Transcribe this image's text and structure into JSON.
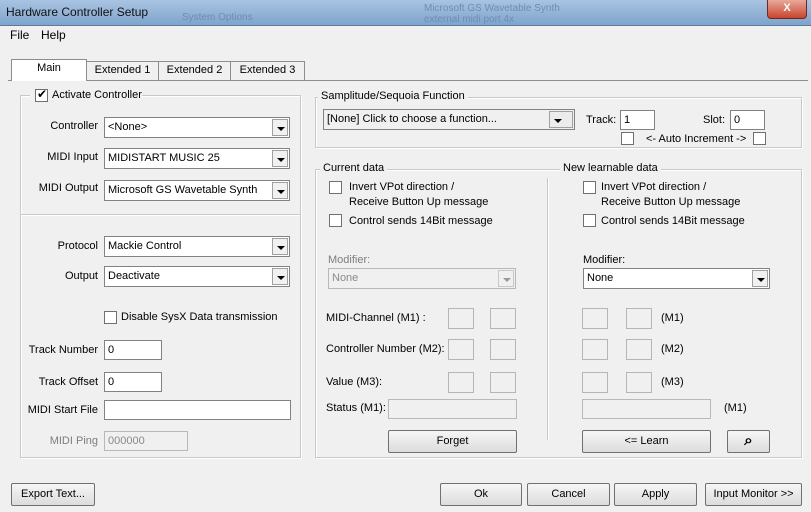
{
  "window": {
    "title": "Hardware Controller Setup",
    "bg_text_1": "System Options",
    "bg_text_2": "Microsoft GS Wavetable Synth",
    "bg_text_3": "external midi port 4x",
    "close_label": "X"
  },
  "menu": [
    "File",
    "Help"
  ],
  "tabs": [
    "Main",
    "Extended 1",
    "Extended 2",
    "Extended 3"
  ],
  "left": {
    "activate_label": "Activate Controller",
    "activate_checked": true,
    "check_mark": "✔",
    "controller_label": "Controller",
    "controller_value": "<None>",
    "midi_input_label": "MIDI Input",
    "midi_input_value": "MIDISTART MUSIC 25",
    "midi_output_label": "MIDI Output",
    "midi_output_value": "Microsoft GS Wavetable Synth",
    "protocol_label": "Protocol",
    "protocol_value": "Mackie Control",
    "output_label": "Output",
    "output_value": "Deactivate",
    "disable_sysx_label": "Disable SysX Data transmission",
    "disable_sysx_checked": false,
    "track_number_label": "Track Number",
    "track_number_value": "0",
    "track_offset_label": "Track Offset",
    "track_offset_value": "0",
    "midi_start_file_label": "MIDI Start File",
    "midi_start_file_value": "",
    "midi_ping_label": "MIDI Ping",
    "midi_ping_value": "000000"
  },
  "function": {
    "group_title": "Samplitude/Sequoia Function",
    "value": "[None] Click to choose a function...",
    "track_label": "Track:",
    "track_value": "1",
    "slot_label": "Slot:",
    "slot_value": "0",
    "auto_increment_label": "<- Auto Increment ->"
  },
  "current": {
    "title": "Current data",
    "invert_label_1": "Invert VPot direction /",
    "invert_label_2": "Receive Button Up message",
    "send14_label": "Control sends 14Bit message",
    "modifier_label": "Modifier:",
    "modifier_value": "None",
    "midi_channel_label": "MIDI-Channel (M1) :",
    "controller_number_label": "Controller Number (M2):",
    "value_label": "Value (M3):",
    "status_label": "Status (M1):",
    "forget_label": "Forget"
  },
  "learn": {
    "title": "New learnable data",
    "invert_label_1": "Invert VPot direction /",
    "invert_label_2": "Receive Button Up message",
    "send14_label": "Control sends 14Bit message",
    "modifier_label": "Modifier:",
    "modifier_value": "None",
    "m1_label": "(M1)",
    "m2_label": "(M2)",
    "m3_label": "(M3)",
    "status_m1_label": "(M1)",
    "learn_label": "<= Learn",
    "binoculars_glyph": "⌕"
  },
  "footer": {
    "export_label": "Export Text...",
    "ok_label": "Ok",
    "cancel_label": "Cancel",
    "apply_label": "Apply",
    "input_monitor_label": "Input Monitor >>"
  }
}
